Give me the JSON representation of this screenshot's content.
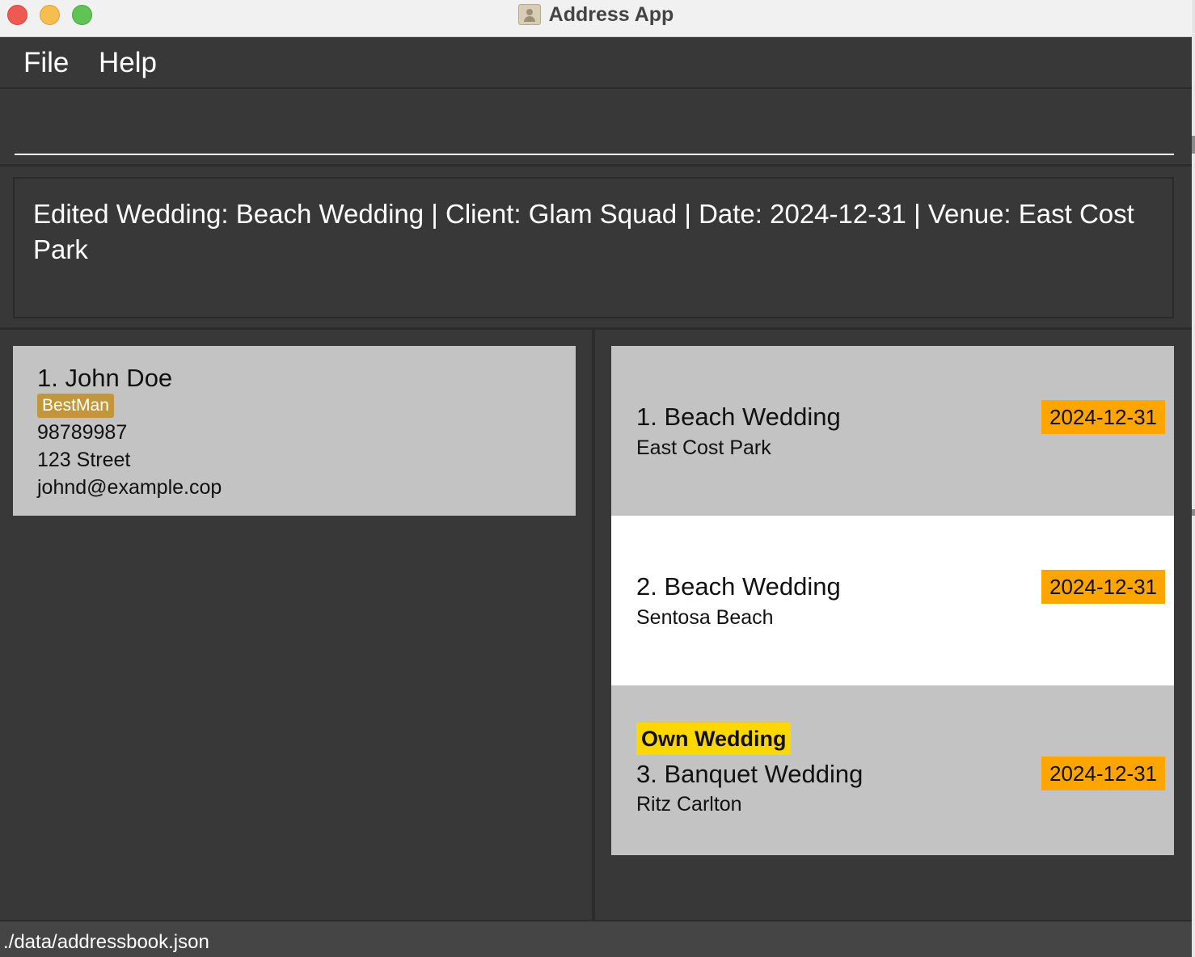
{
  "window": {
    "title": "Address App"
  },
  "menu": {
    "file_label": "File",
    "help_label": "Help"
  },
  "command": {
    "value": ""
  },
  "result": {
    "message": "Edited Wedding: Beach Wedding | Client: Glam Squad | Date: 2024-12-31 | Venue: East Cost Park"
  },
  "persons": [
    {
      "name": "1. John Doe",
      "tag": "BestMan",
      "phone": "98789987",
      "address": "123 Street",
      "email": "johnd@example.cop"
    }
  ],
  "weddings": [
    {
      "title": "1. Beach Wedding",
      "venue": "East Cost Park",
      "date": "2024-12-31",
      "own_tag": ""
    },
    {
      "title": "2. Beach Wedding",
      "venue": "Sentosa Beach",
      "date": "2024-12-31",
      "own_tag": ""
    },
    {
      "title": "3. Banquet Wedding",
      "venue": "Ritz Carlton",
      "date": "2024-12-31",
      "own_tag": "Own Wedding"
    }
  ],
  "status": {
    "path": "./data/addressbook.json"
  },
  "colors": {
    "background": "#383838",
    "card": "#c3c3c3",
    "selected_card": "#ffffff",
    "date_badge": "#ffa500",
    "own_wedding_tag": "#ffd700",
    "person_tag": "#c2963a"
  }
}
